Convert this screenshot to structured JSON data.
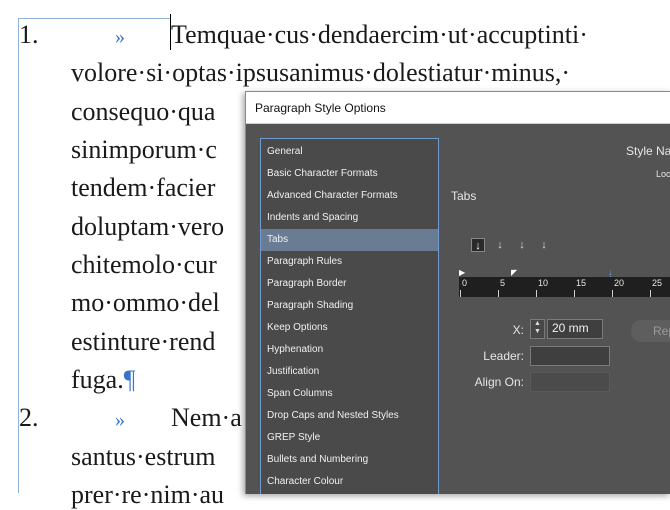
{
  "document": {
    "paragraph1": {
      "number": "1.",
      "tab_marker": "»",
      "lines": [
        "Temquae·cus·dendaercim·ut·accuptinti·",
        "volore·si·optas·ipsusanimus·dolestiatur·minus,·",
        "consequo·qua",
        "sinimporum·c",
        "tendem·facier",
        "doluptam·vero",
        "chitemolo·cur",
        "mo·ommo·del",
        "estinture·rend",
        "fuga."
      ],
      "end_mark": "¶"
    },
    "paragraph2": {
      "number": "2.",
      "tab_marker": "»",
      "lines": [
        "Nem·a",
        "santus·estrum",
        "prer·re·nim·au"
      ]
    }
  },
  "dialog": {
    "title": "Paragraph Style Options",
    "categories": [
      "General",
      "Basic Character Formats",
      "Advanced Character Formats",
      "Indents and Spacing",
      "Tabs",
      "Paragraph Rules",
      "Paragraph Border",
      "Paragraph Shading",
      "Keep Options",
      "Hyphenation",
      "Justification",
      "Span Columns",
      "Drop Caps and Nested Styles",
      "GREP Style",
      "Bullets and Numbering",
      "Character Colour"
    ],
    "selected_category": "Tabs",
    "style_name_label": "Style Na",
    "location_label": "Loc",
    "section_title": "Tabs",
    "tab_alignment_icons": [
      "left-justified-tab-icon",
      "center-justified-tab-icon",
      "right-justified-tab-icon",
      "align-to-decimal-tab-icon"
    ],
    "ruler_labels": [
      "0",
      "5",
      "10",
      "15",
      "20",
      "25"
    ],
    "x_label": "X:",
    "x_value": "20 mm",
    "leader_label": "Leader:",
    "leader_value": "",
    "align_on_label": "Align On:",
    "align_on_value": "",
    "repeat_button_label": "Rep",
    "colors": {
      "dialog_bg": "#535353",
      "selection": "#6a7c93",
      "accent": "#3b73c9"
    }
  }
}
